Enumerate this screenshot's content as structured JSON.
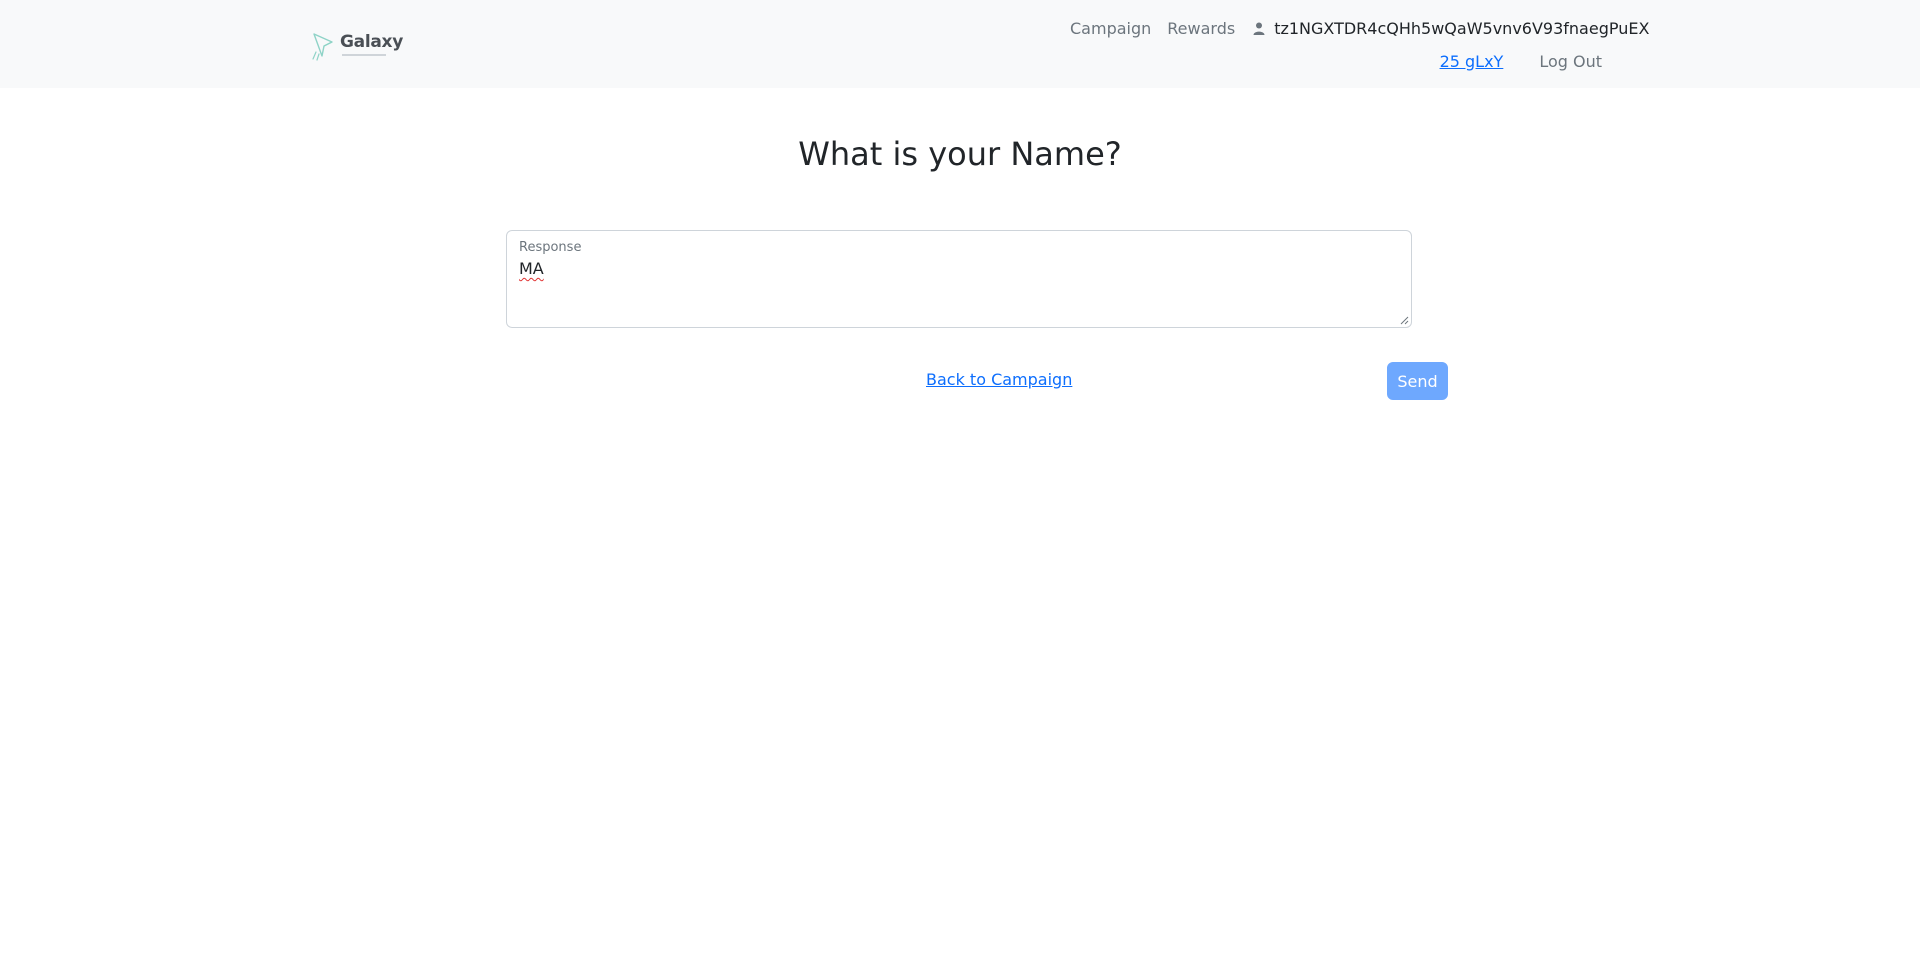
{
  "app": {
    "logo_text": "Galaxy",
    "logo_icon": "rocket-icon"
  },
  "nav": {
    "campaign_label": "Campaign",
    "rewards_label": "Rewards",
    "user_icon": "person-icon",
    "username": "tz1NGXTDR4cQHh5wQaW5vnv6V93fnaegPuEX",
    "balance": "25 gLxY",
    "logout_label": "Log Out"
  },
  "main": {
    "question": "What is your Name?",
    "response_label": "Response",
    "response_value": "MA",
    "back_label": "Back to Campaign",
    "send_label": "Send"
  },
  "colors": {
    "accent": "#0d6efd",
    "button_disabled": "#6ea8fe",
    "navbar_bg": "#f8f9fa"
  }
}
